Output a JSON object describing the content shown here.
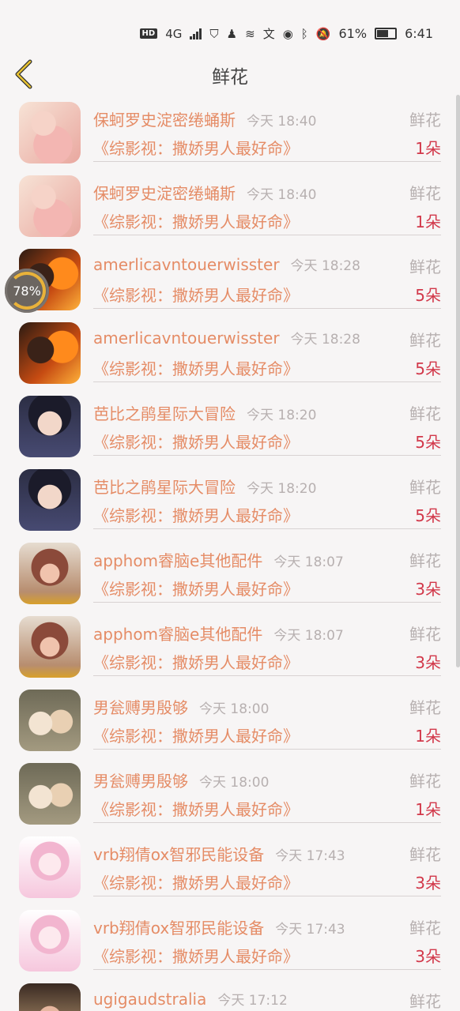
{
  "status_bar": {
    "hd": "HD",
    "net": "4G",
    "battery": "61%",
    "time": "6:41"
  },
  "header": {
    "title": "鲜花"
  },
  "float_badge": {
    "label": "78%"
  },
  "rows": [
    {
      "name": "保蚵罗史淀密绻蛹斯",
      "time": "今天 18:40",
      "type": "鲜花",
      "book": "《综影视：撒娇男人最好命》",
      "count": "1朵",
      "avatar": "a1"
    },
    {
      "name": "保蚵罗史淀密绻蛹斯",
      "time": "今天 18:40",
      "type": "鲜花",
      "book": "《综影视：撒娇男人最好命》",
      "count": "1朵",
      "avatar": "a1"
    },
    {
      "name": "amerlicavntouerwisster",
      "time": "今天 18:28",
      "type": "鲜花",
      "book": "《综影视：撒娇男人最好命》",
      "count": "5朵",
      "avatar": "a2"
    },
    {
      "name": "amerlicavntouerwisster",
      "time": "今天 18:28",
      "type": "鲜花",
      "book": "《综影视：撒娇男人最好命》",
      "count": "5朵",
      "avatar": "a2"
    },
    {
      "name": "芭比之鹃星际大冒险",
      "time": "今天 18:20",
      "type": "鲜花",
      "book": "《综影视：撒娇男人最好命》",
      "count": "5朵",
      "avatar": "a3"
    },
    {
      "name": "芭比之鹃星际大冒险",
      "time": "今天 18:20",
      "type": "鲜花",
      "book": "《综影视：撒娇男人最好命》",
      "count": "5朵",
      "avatar": "a3"
    },
    {
      "name": "apphom睿脑e其他配件",
      "time": "今天 18:07",
      "type": "鲜花",
      "book": "《综影视：撒娇男人最好命》",
      "count": "3朵",
      "avatar": "a4"
    },
    {
      "name": "apphom睿脑e其他配件",
      "time": "今天 18:07",
      "type": "鲜花",
      "book": "《综影视：撒娇男人最好命》",
      "count": "3朵",
      "avatar": "a4"
    },
    {
      "name": "男瓮赙男殷够",
      "time": "今天 18:00",
      "type": "鲜花",
      "book": "《综影视：撒娇男人最好命》",
      "count": "1朵",
      "avatar": "a5"
    },
    {
      "name": "男瓮赙男殷够",
      "time": "今天 18:00",
      "type": "鲜花",
      "book": "《综影视：撒娇男人最好命》",
      "count": "1朵",
      "avatar": "a5"
    },
    {
      "name": "vrb翔倩ox智邪民能设备",
      "time": "今天 17:43",
      "type": "鲜花",
      "book": "《综影视：撒娇男人最好命》",
      "count": "3朵",
      "avatar": "a6"
    },
    {
      "name": "vrb翔倩ox智邪民能设备",
      "time": "今天 17:43",
      "type": "鲜花",
      "book": "《综影视：撒娇男人最好命》",
      "count": "3朵",
      "avatar": "a6"
    },
    {
      "name": "ugigaudstralia",
      "time": "今天 17:12",
      "type": "鲜花",
      "book": "",
      "count": "",
      "avatar": "a7"
    }
  ]
}
